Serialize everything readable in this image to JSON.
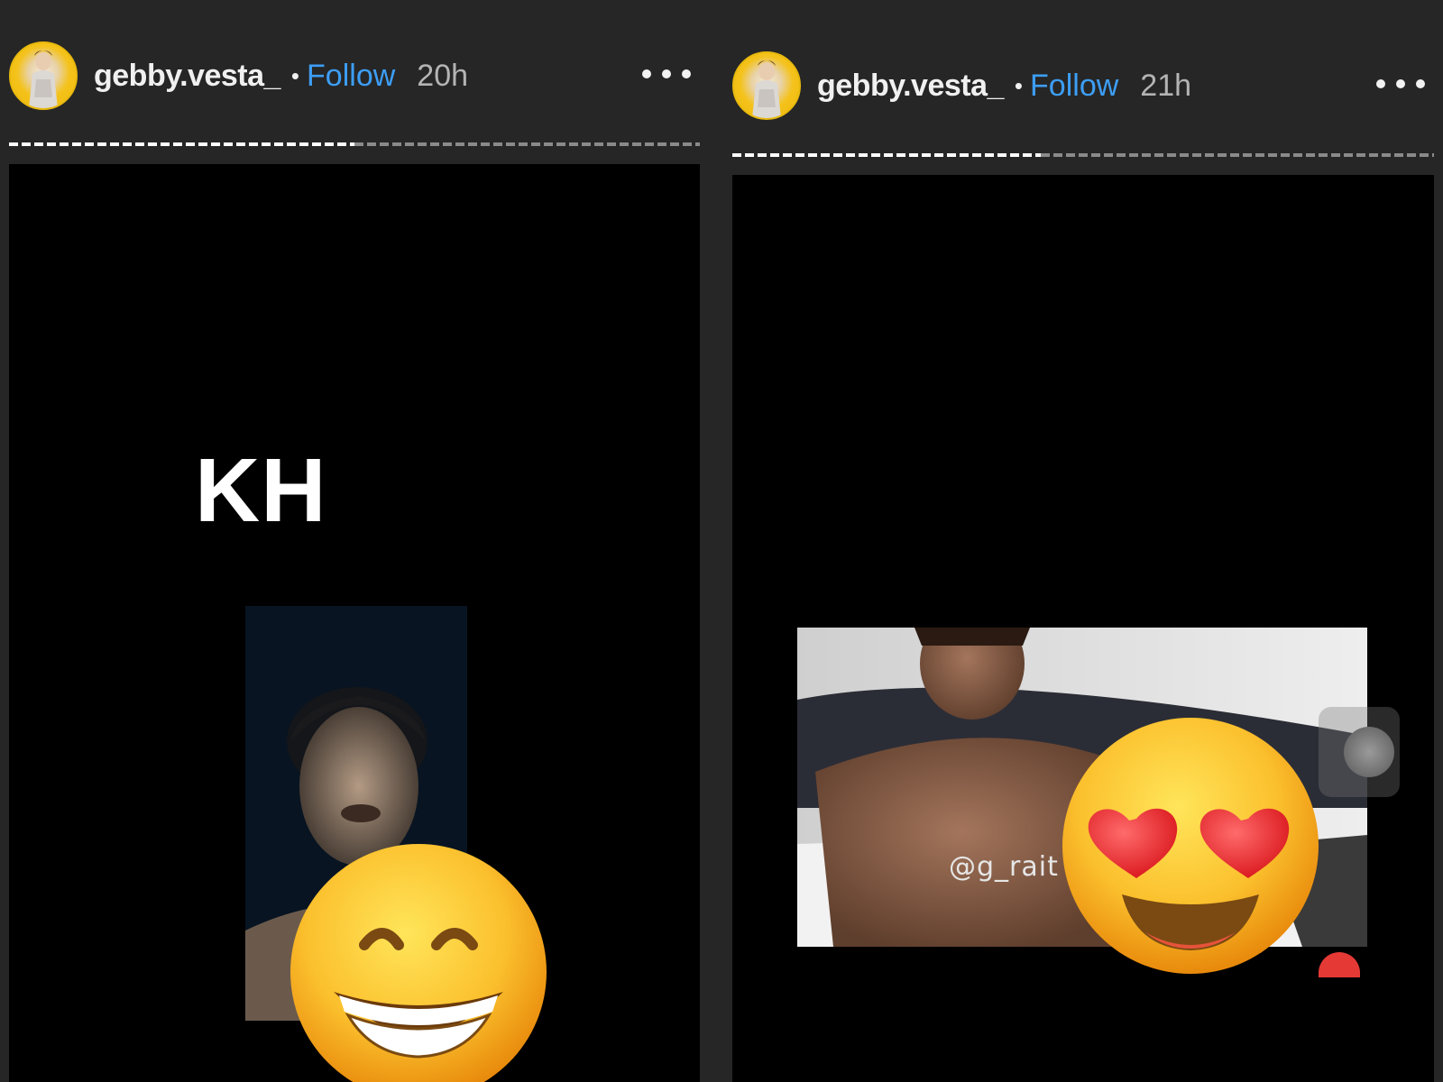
{
  "stories": [
    {
      "username": "gebby.vesta_",
      "separator": "•",
      "follow_label": "Follow",
      "time_ago": "20h",
      "progress": 0.5,
      "overlay_text": "KH",
      "emoji": "grinning-face-with-smiling-eyes"
    },
    {
      "username": "gebby.vesta_",
      "separator": "•",
      "follow_label": "Follow",
      "time_ago": "21h",
      "progress": 0.44,
      "video_handle": "@g_rait",
      "emoji": "smiling-face-with-heart-eyes"
    }
  ],
  "colors": {
    "background": "#262626",
    "follow": "#3d9ef5",
    "media": "#000000"
  }
}
